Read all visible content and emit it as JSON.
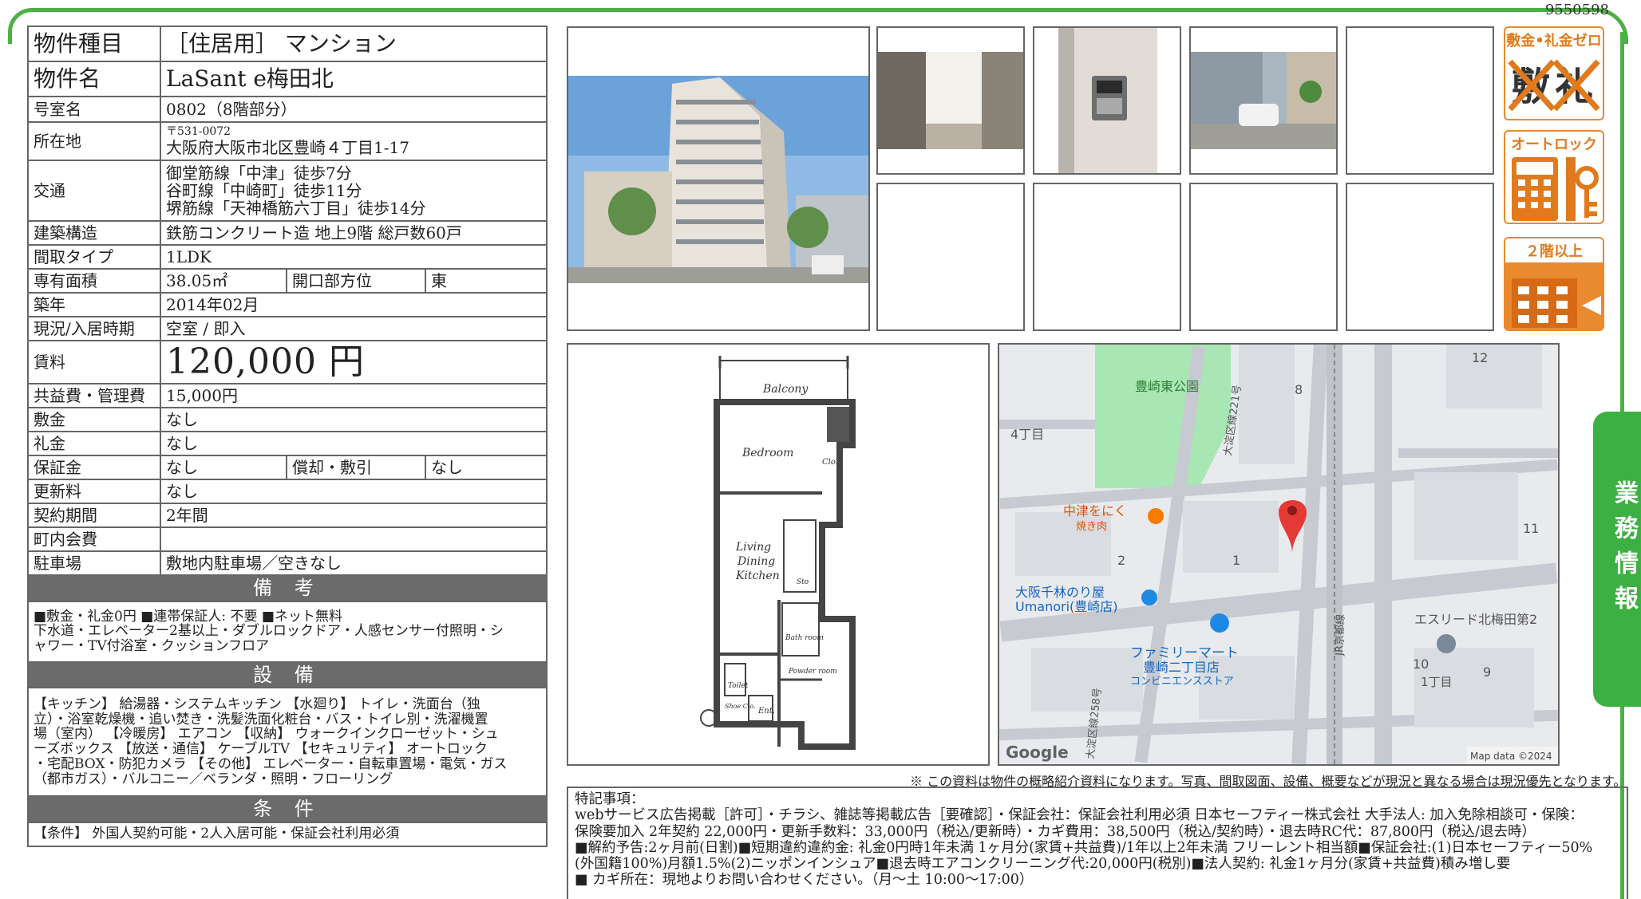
{
  "doc_id": "9550598",
  "property": {
    "type_label": "物件種目",
    "type_value": "［住居用］ マンション",
    "name_label": "物件名",
    "name_value": "LaSant e梅田北",
    "room_label": "号室名",
    "room_value": "0802（8階部分）",
    "address_label": "所在地",
    "postal": "〒531-0072",
    "address_value": "大阪府大阪市北区豊崎４丁目1-17",
    "transit_label": "交通",
    "transit": [
      "御堂筋線「中津」徒歩7分",
      "谷町線「中崎町」徒歩11分",
      "堺筋線「天神橋筋六丁目」徒歩14分"
    ],
    "structure_label": "建築構造",
    "structure_value": "鉄筋コンクリート造 地上9階 総戸数60戸",
    "layout_label": "間取タイプ",
    "layout_value": "1LDK",
    "area_label": "専有面積",
    "area_value": "38.05㎡",
    "direction_label": "開口部方位",
    "direction_value": "東",
    "built_label": "築年",
    "built_value": "2014年02月",
    "status_label": "現況/入居時期",
    "status_value": "空室 / 即入",
    "rent_label": "賃料",
    "rent_value": "120,000 円",
    "fee_label": "共益費・管理費",
    "fee_value": "15,000円",
    "deposit_label": "敷金",
    "deposit_value": "なし",
    "key_money_label": "礼金",
    "key_money_value": "なし",
    "guarantee_label": "保証金",
    "guarantee_value": "なし",
    "amort_label": "償却・敷引",
    "amort_value": "なし",
    "renewal_label": "更新料",
    "renewal_value": "なし",
    "contract_label": "契約期間",
    "contract_value": "2年間",
    "community_label": "町内会費",
    "community_value": "",
    "parking_label": "駐車場",
    "parking_value": "敷地内駐車場／空きなし"
  },
  "remarks": {
    "title": "備 考",
    "lines": [
      "■敷金・礼金0円 ■連帯保証人: 不要 ■ネット無料",
      "下水道・エレベーター2基以上・ダブルロックドア・人感センサー付照明・シ",
      "ャワー・TV付浴室・クッションフロア"
    ]
  },
  "equipment": {
    "title": "設 備",
    "lines": [
      "【キッチン】 給湯器・システムキッチン 【水廻り】 トイレ・洗面台（独",
      "立）・浴室乾燥機・追い焚き・洗髪洗面化粧台・バス・トイレ別・洗濯機置",
      "場（室内） 【冷暖房】 エアコン 【収納】 ウォークインクローゼット・シュ",
      "ーズボックス 【放送・通信】 ケーブルTV 【セキュリティ】 オートロック",
      "・宅配BOX・防犯カメラ 【その他】 エレベーター・自転車置場・電気・ガス",
      "（都市ガス）・バルコニー／ベランダ・照明・フローリング"
    ]
  },
  "conditions": {
    "title": "条 件",
    "text": "【条件】 外国人契約可能・2人入居可能・保証会社利用必須"
  },
  "badges": [
    "敷金•礼金ゼロ",
    "オートロック",
    "２階以上"
  ],
  "floorplan": {
    "rooms": [
      "Balcony",
      "Bedroom",
      "Clo.",
      "Living",
      "Dining",
      "Kitchen",
      "Sto",
      "Bath room",
      "Powder room",
      "Toilet",
      "Shoe Clo.",
      "Ent."
    ]
  },
  "map": {
    "labels": [
      "豊崎東公園",
      "4丁目",
      "中津をにく",
      "焼き肉",
      "大阪千林のり屋",
      "Umanori(豊崎店)",
      "ファミリーマート",
      "豊崎二丁目店",
      "コンビニエンスストア",
      "エスリード北梅田第2",
      "1丁目",
      "大淀区線221号",
      "JR京都線",
      "大淀区線258号"
    ],
    "numbers": [
      "12",
      "8",
      "2",
      "1",
      "11",
      "10",
      "9"
    ],
    "google": "Google",
    "mapdata": "Map data ©2024"
  },
  "disclaimer": "※ この資料は物件の概略紹介資料になります。写真、間取図面、設備、概要などが現況と異なる場合は現況優先となります。",
  "notes": [
    "特記事項：",
    "webサービス広告掲載［許可］・チラシ、雑誌等掲載広告［要確認］・保証会社：保証会社利用必須 日本セーフティー株式会社 大手法人: 加入免除相談可・保険：",
    "保険要加入 2年契約 22,000円・更新手数料：33,000円（税込/更新時）・カギ費用：38,500円（税込/契約時）・退去時RC代：87,800円（税込/退去時）",
    "■解約予告:2ヶ月前(日割)■短期違約違約金: 礼金0円時1年未満 1ヶ月分(家賃+共益費)/1年以上2年未満 フリーレント相当額■保証会社:(1)日本セーフティー50%",
    "(外国籍100%)月額1.5%(2)ニッポンインシュア■退去時エアコンクリーニング代:20,000円(税別)■法人契約: 礼金1ヶ月分(家賃+共益費)積み増し要",
    "■ カギ所在：現地よりお問い合わせください。（月〜土 10:00〜17:00）"
  ],
  "side_tab": "業務情報",
  "colors": {
    "accent_green": "#4db043",
    "section_gray": "#6b6b6b",
    "badge_orange": "#e07a1c"
  }
}
